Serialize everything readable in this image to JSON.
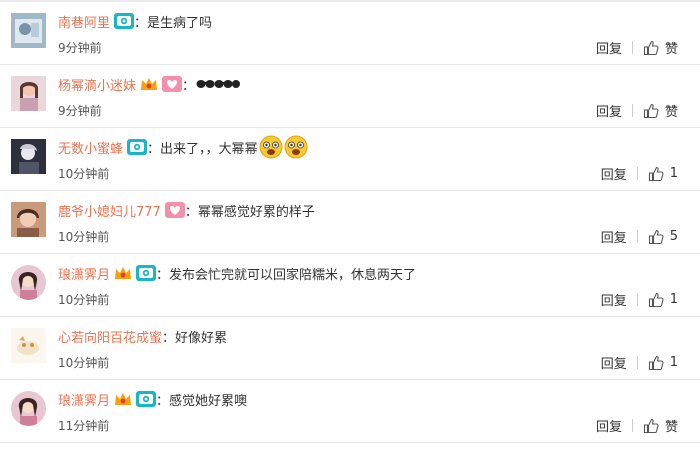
{
  "comments": [
    {
      "user": "南巷阿里",
      "text": "：是生病了吗",
      "time": "9分钟前",
      "reply": "回复",
      "likes": "赞"
    },
    {
      "user": "杨幂滴小迷妹",
      "text": "：",
      "time": "9分钟前",
      "reply": "回复",
      "likes": "赞"
    },
    {
      "user": "无数小蜜蜂",
      "text": "：出来了，，大幂幂",
      "time": "10分钟前",
      "reply": "回复",
      "likes": "1"
    },
    {
      "user": "鹿爷小媳妇儿777",
      "text": "：幂幂感觉好累的样子",
      "time": "10分钟前",
      "reply": "回复",
      "likes": "5"
    },
    {
      "user": "琅潇霁月",
      "text": "：发布会忙完就可以回家陪糯米，休息两天了",
      "time": "10分钟前",
      "reply": "回复",
      "likes": "1"
    },
    {
      "user": "心若向阳百花成蜜",
      "text": "：好像好累",
      "time": "10分钟前",
      "reply": "回复",
      "likes": "1"
    },
    {
      "user": "琅潇霁月",
      "text": "：感觉她好累噢",
      "time": "11分钟前",
      "reply": "回复",
      "likes": "赞"
    }
  ],
  "colors": {
    "username": "#eb7350",
    "separator": "#e6e6e6",
    "vip_badge": "#19b6c6",
    "heart_badge": "#f58fae",
    "fan_badge": "#f7a10b"
  },
  "icons": [
    "camera-vip-icon",
    "heart-badge-icon",
    "fan-crown-icon",
    "thumbs-up-icon",
    "sunglasses-emoji",
    "surprised-face-emoji"
  ]
}
